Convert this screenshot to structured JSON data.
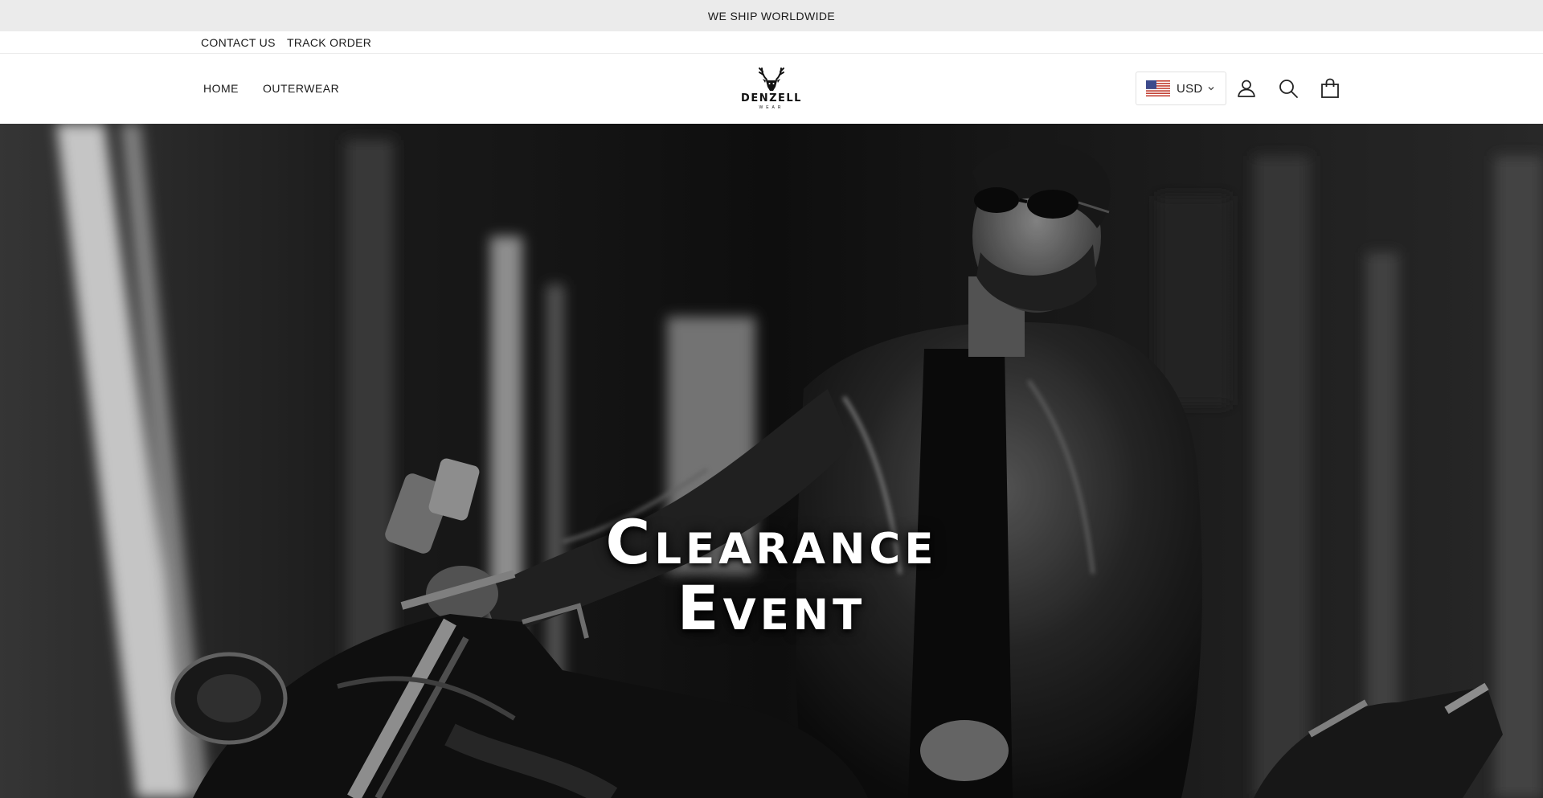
{
  "announcement": {
    "text": "WE SHIP WORLDWIDE"
  },
  "utility_nav": {
    "contact": "CONTACT US",
    "track": "TRACK ORDER"
  },
  "main_nav": {
    "home": "HOME",
    "outerwear": "OUTERWEAR"
  },
  "logo": {
    "name": "DENZELL",
    "sub": "WEAR"
  },
  "currency": {
    "code": "USD",
    "flag": "us-flag-icon"
  },
  "header_icons": [
    "user-icon",
    "search-icon",
    "cart-icon"
  ],
  "hero": {
    "line1": "Clearance",
    "line2": "Event"
  },
  "colors": {
    "announce_bg": "#ebebeb",
    "text": "#1a1a1a",
    "hero_text": "#ffffff"
  }
}
